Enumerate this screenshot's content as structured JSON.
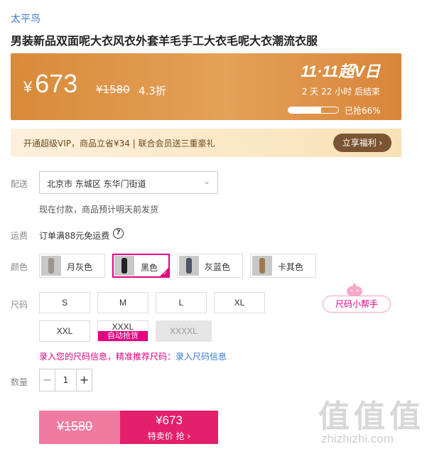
{
  "brand": "太平鸟",
  "product_title": "男装新品双面呢大衣风衣外套羊毛手工大衣毛呢大衣潮流衣服",
  "price_banner": {
    "currency": "¥",
    "price": "673",
    "original_price": "¥1580",
    "discount": "4.3折",
    "promo_logo": "11·11超V日",
    "countdown": "2 天 22 小时 后结束",
    "sold_percent": 66,
    "sold_text": "已抢66%"
  },
  "vip": {
    "text": "开通超级VIP，商品立省¥34 | 联合会员送三重豪礼",
    "button": "立享福利 ›"
  },
  "delivery": {
    "label": "配送",
    "address": "北京市 东城区 东华门街道",
    "note": "现在付款，商品预计明天前发货"
  },
  "shipping": {
    "label": "运费",
    "text": "订单满88元免运费"
  },
  "color": {
    "label": "颜色",
    "options": [
      {
        "label": "月灰色",
        "swatch": "#9b958c"
      },
      {
        "label": "黑色",
        "swatch": "#222222"
      },
      {
        "label": "灰蓝色",
        "swatch": "#4a5566"
      },
      {
        "label": "卡其色",
        "swatch": "#a07a4e"
      }
    ],
    "selected": "黑色"
  },
  "size": {
    "label": "尺码",
    "options": [
      "S",
      "M",
      "L",
      "XL",
      "XXL",
      "XXXL",
      "XXXXL"
    ],
    "xxxl_tag": "自动抢货",
    "helper": "尺码小帮手",
    "info_text": "录入您的尺码信息，精准推荐尺码：",
    "info_link": "录入尺码信息"
  },
  "quantity": {
    "label": "数量",
    "value": "1"
  },
  "buy": {
    "original_price": "¥1580",
    "price": "¥673",
    "action": "特卖价 抢 ›"
  },
  "watermark": {
    "glyphs": "值值值",
    "text": "zhizhizhi.com"
  },
  "colors": {
    "accent": "#e4007f",
    "banner": "#e09a4f",
    "buy": "#e41f6b",
    "link": "#3a7bd5"
  }
}
